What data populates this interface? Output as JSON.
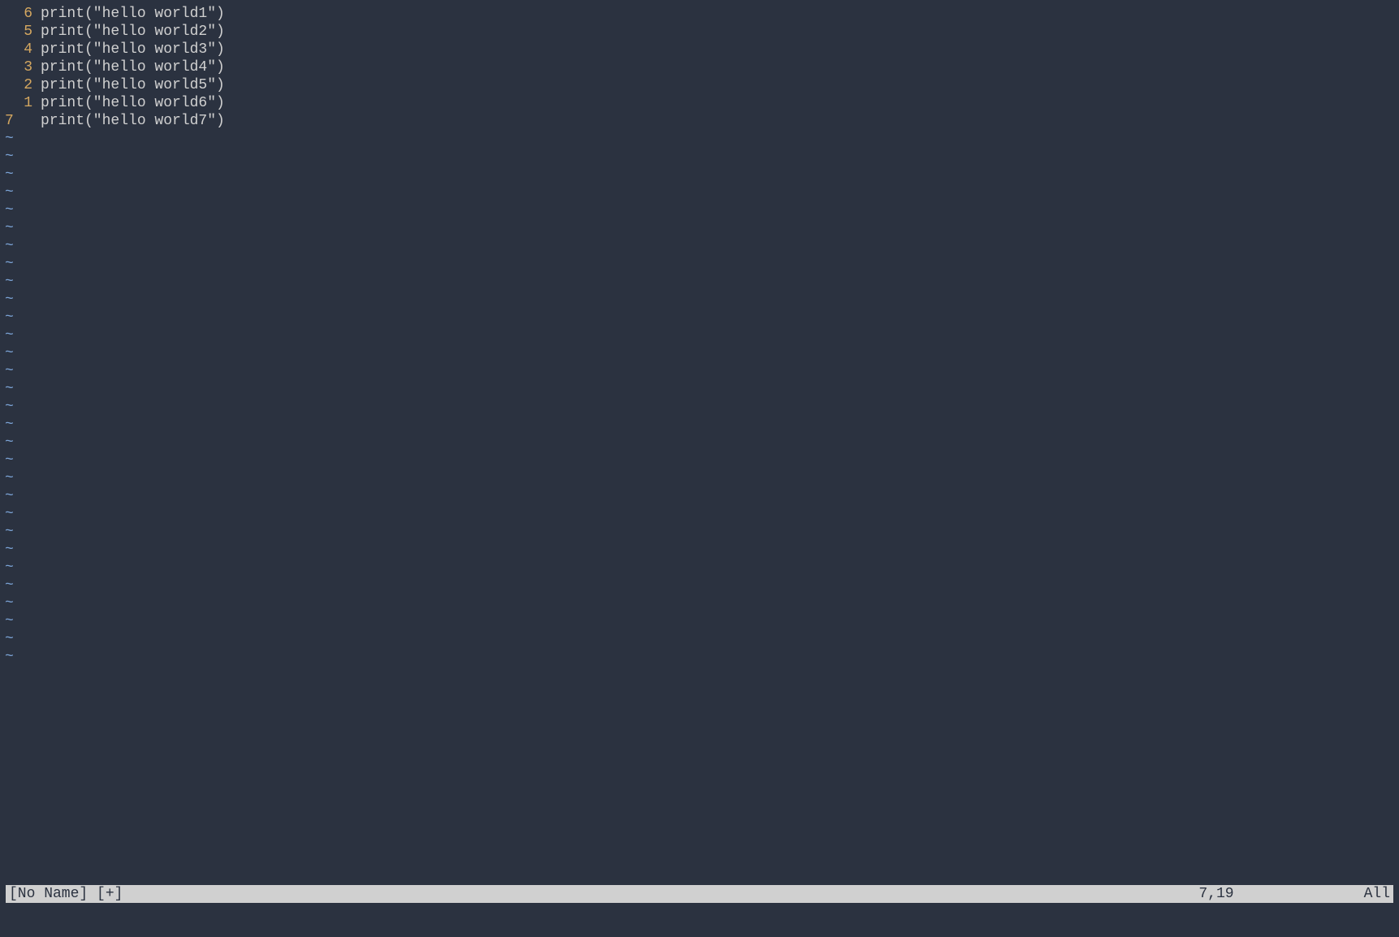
{
  "editor": {
    "lines": [
      {
        "gutter": "6",
        "current": false,
        "text": "print(\"hello world1\")"
      },
      {
        "gutter": "5",
        "current": false,
        "text": "print(\"hello world2\")"
      },
      {
        "gutter": "4",
        "current": false,
        "text": "print(\"hello world3\")"
      },
      {
        "gutter": "3",
        "current": false,
        "text": "print(\"hello world4\")"
      },
      {
        "gutter": "2",
        "current": false,
        "text": "print(\"hello world5\")"
      },
      {
        "gutter": "1",
        "current": false,
        "text": "print(\"hello world6\")"
      },
      {
        "gutter": "7",
        "current": true,
        "text": "print(\"hello world7\")"
      }
    ],
    "tilde": "~",
    "tilde_count": 30
  },
  "status": {
    "filename": "[No Name] [+]",
    "position": "7,19",
    "scroll": "All"
  }
}
